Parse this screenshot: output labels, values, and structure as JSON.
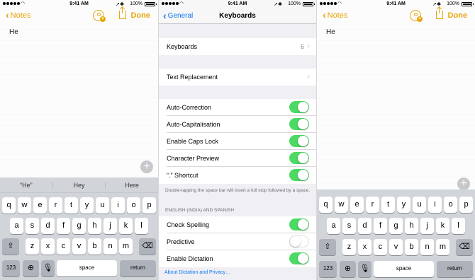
{
  "status": {
    "time": "9:41 AM",
    "battery": "100%"
  },
  "notes": {
    "back_label": "Notes",
    "done_label": "Done",
    "body_text": "He"
  },
  "predictive": [
    "“He”",
    "Hey",
    "Here"
  ],
  "keyboard": {
    "row1": [
      "q",
      "w",
      "e",
      "r",
      "t",
      "y",
      "u",
      "i",
      "o",
      "p"
    ],
    "row2": [
      "a",
      "s",
      "d",
      "f",
      "g",
      "h",
      "j",
      "k",
      "l"
    ],
    "row3": [
      "z",
      "x",
      "c",
      "v",
      "b",
      "n",
      "m"
    ],
    "numbers_key": "123",
    "space_key": "space",
    "return_key": "return"
  },
  "settings": {
    "back_label": "General",
    "title": "Keyboards",
    "keyboards_label": "Keyboards",
    "keyboards_count": "6",
    "text_replacement_label": "Text Replacement",
    "toggles": [
      {
        "label": "Auto-Correction",
        "on": true
      },
      {
        "label": "Auto-Capitalisation",
        "on": true
      },
      {
        "label": "Enable Caps Lock",
        "on": true
      },
      {
        "label": "Character Preview",
        "on": true
      },
      {
        "label": "“.” Shortcut",
        "on": true
      }
    ],
    "shortcut_footer": "Double-tapping the space bar will insert a full stop followed by a space.",
    "section_header": "ENGLISH (INDIA) AND SPANISH",
    "lang_toggles": [
      {
        "label": "Check Spelling",
        "on": true
      },
      {
        "label": "Predictive",
        "on": false
      },
      {
        "label": "Enable Dictation",
        "on": true
      }
    ],
    "dictation_link": "About Dictation and Privacy…"
  },
  "colors": {
    "notes_accent": "#e7a50a",
    "ios_blue": "#0a76f6",
    "toggle_on": "#4cd964"
  }
}
